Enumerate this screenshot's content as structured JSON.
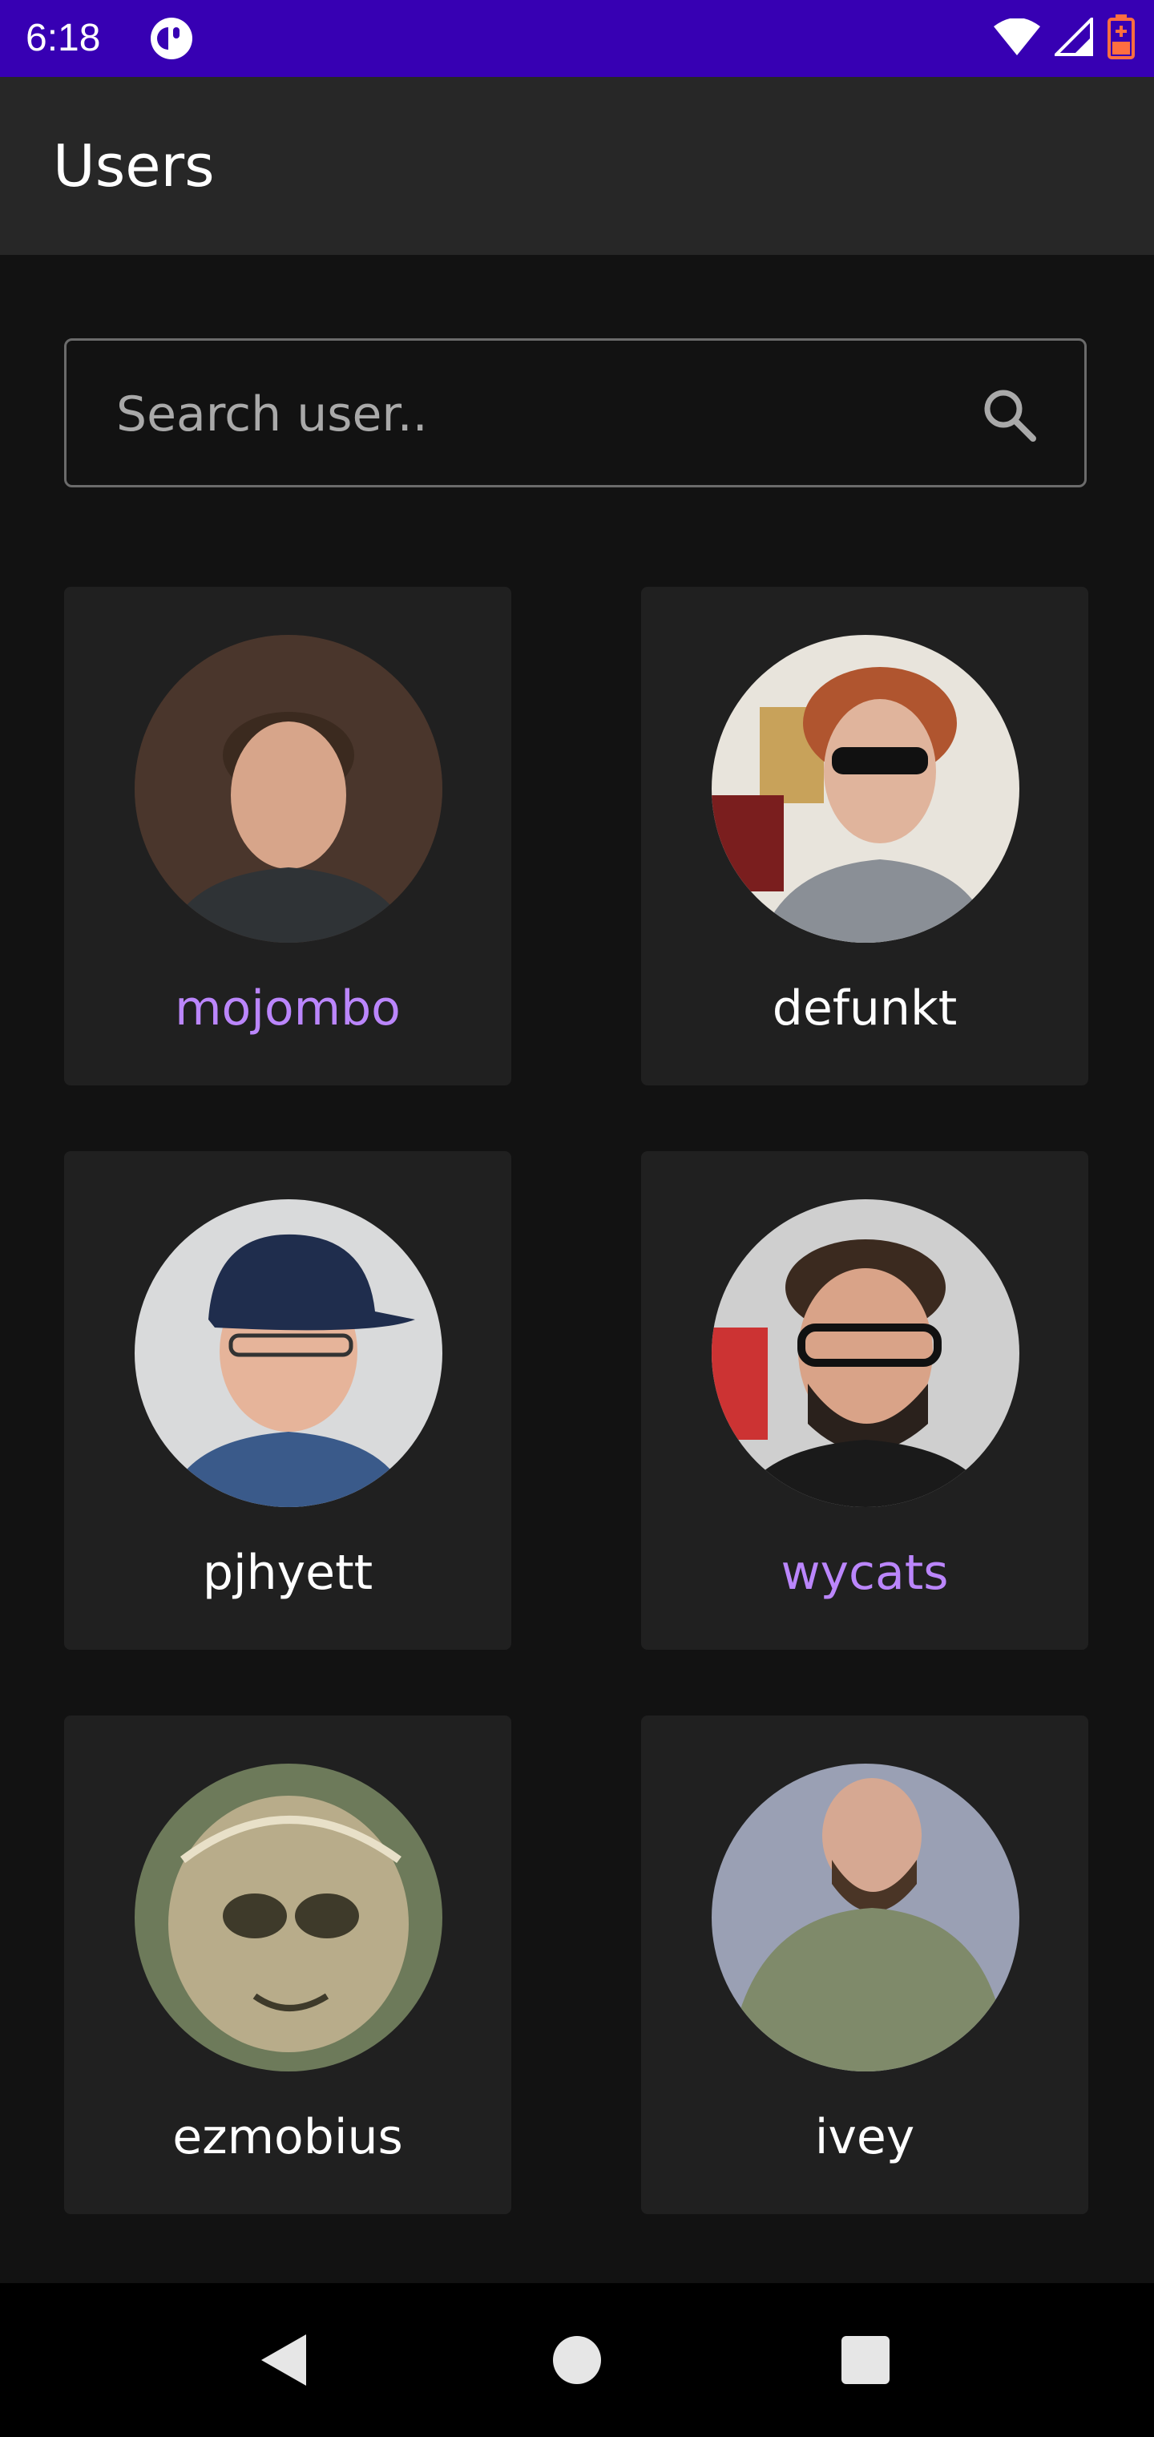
{
  "status_bar": {
    "time": "6:18"
  },
  "app_bar": {
    "title": "Users"
  },
  "search": {
    "placeholder": "Search user.."
  },
  "users": [
    {
      "login": "mojombo",
      "highlighted": true
    },
    {
      "login": "defunkt",
      "highlighted": false
    },
    {
      "login": "pjhyett",
      "highlighted": false
    },
    {
      "login": "wycats",
      "highlighted": true
    },
    {
      "login": "ezmobius",
      "highlighted": false
    },
    {
      "login": "ivey",
      "highlighted": false
    }
  ],
  "colors": {
    "status_bar": "#3700b3",
    "app_bar": "#272727",
    "background": "#121212",
    "card": "#202020",
    "accent": "#bb86fc"
  },
  "icons": {
    "search": "search-icon",
    "back": "back-triangle-icon",
    "home": "home-circle-icon",
    "recents": "recents-square-icon",
    "wifi": "wifi-icon",
    "signal": "signal-icon",
    "battery": "battery-icon"
  }
}
